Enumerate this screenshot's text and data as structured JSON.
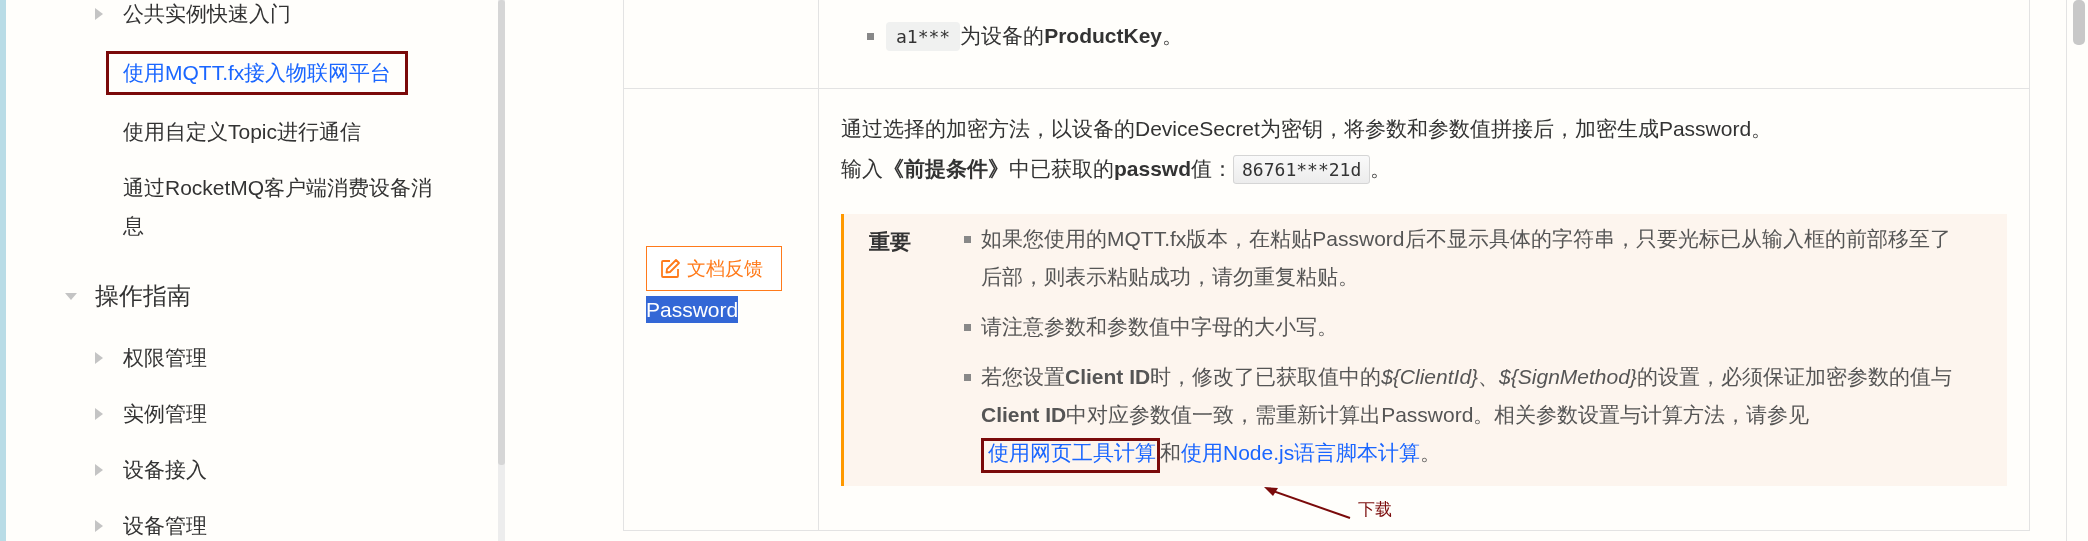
{
  "sidebar": {
    "items": [
      {
        "children": [
          {
            "label": "公共实例快速入门",
            "kind": "folder",
            "expanded": false,
            "selected": false,
            "boxed": false
          },
          {
            "label": "使用MQTT.fx接入物联网平台",
            "kind": "page",
            "selected": true,
            "boxed": true
          },
          {
            "label": "使用自定义Topic进行通信",
            "kind": "page",
            "selected": false,
            "boxed": false
          },
          {
            "label": "通过RocketMQ客户端消费设备消息",
            "kind": "page",
            "selected": false,
            "boxed": false
          }
        ]
      },
      {
        "label": "操作指南",
        "kind": "section",
        "expanded": true,
        "children": [
          {
            "label": "权限管理",
            "kind": "folder",
            "expanded": false,
            "selected": false,
            "boxed": false
          },
          {
            "label": "实例管理",
            "kind": "folder",
            "expanded": false,
            "selected": false,
            "boxed": false
          },
          {
            "label": "设备接入",
            "kind": "folder",
            "expanded": false,
            "selected": false,
            "boxed": false
          },
          {
            "label": "设备管理",
            "kind": "folder",
            "expanded": false,
            "selected": false,
            "boxed": false
          }
        ]
      }
    ]
  },
  "feedback_button": {
    "label": "文档反馈"
  },
  "table": {
    "rows": [
      {
        "blocks": [
          {
            "kind": "bullet",
            "parts": [
              {
                "kind": "code",
                "text": "a1***"
              },
              {
                "kind": "text",
                "text": "为设备的**ProductKey**。"
              }
            ]
          }
        ]
      },
      {
        "parameter": {
          "text": "Password",
          "selected": true
        },
        "blocks": [
          {
            "kind": "paragraph",
            "parts": [
              {
                "kind": "text",
                "text": "通过选择的加密方法，以设备的DeviceSecret为密钥，将参数和参数值拼接后，加密生成Password。"
              }
            ]
          },
          {
            "kind": "paragraph",
            "parts": [
              {
                "kind": "text",
                "text": "输入**《前提条件》**中已获取的**passwd**值："
              },
              {
                "kind": "code_box",
                "text": "86761***21d"
              },
              {
                "kind": "text",
                "text": "。"
              }
            ]
          },
          {
            "kind": "note",
            "label": "重要",
            "items": [
              {
                "parts": [
                  {
                    "kind": "text",
                    "text": "如果您使用的MQTT.fx版本，在粘贴Password后不显示具体的字符串，只要光标已从输入框的前部移至了后部，则表示粘贴成功，请勿重复粘贴。"
                  }
                ]
              },
              {
                "parts": [
                  {
                    "kind": "text",
                    "text": "请注意参数和参数值中字母的大小写。"
                  }
                ]
              },
              {
                "parts": [
                  {
                    "kind": "text",
                    "text": "若您设置**Client ID**时，修改了已获取值中的"
                  },
                  {
                    "kind": "italic",
                    "text": "${ClientId}"
                  },
                  {
                    "kind": "text",
                    "text": "、"
                  },
                  {
                    "kind": "italic",
                    "text": "${SignMethod}"
                  },
                  {
                    "kind": "text",
                    "text": "的设置，必须保证加密参数的值与**Client ID**中对应参数值一致，需重新计算出Password。相关参数设置与计算方法，请参见"
                  },
                  {
                    "kind": "link",
                    "text": "使用网页工具计算",
                    "boxed": true
                  },
                  {
                    "kind": "text",
                    "text": "和"
                  },
                  {
                    "kind": "link",
                    "text": "使用Node.js语言脚本计算",
                    "boxed": false
                  },
                  {
                    "kind": "text",
                    "text": "。"
                  }
                ]
              }
            ]
          }
        ]
      }
    ]
  },
  "callout": {
    "text": "下载"
  }
}
